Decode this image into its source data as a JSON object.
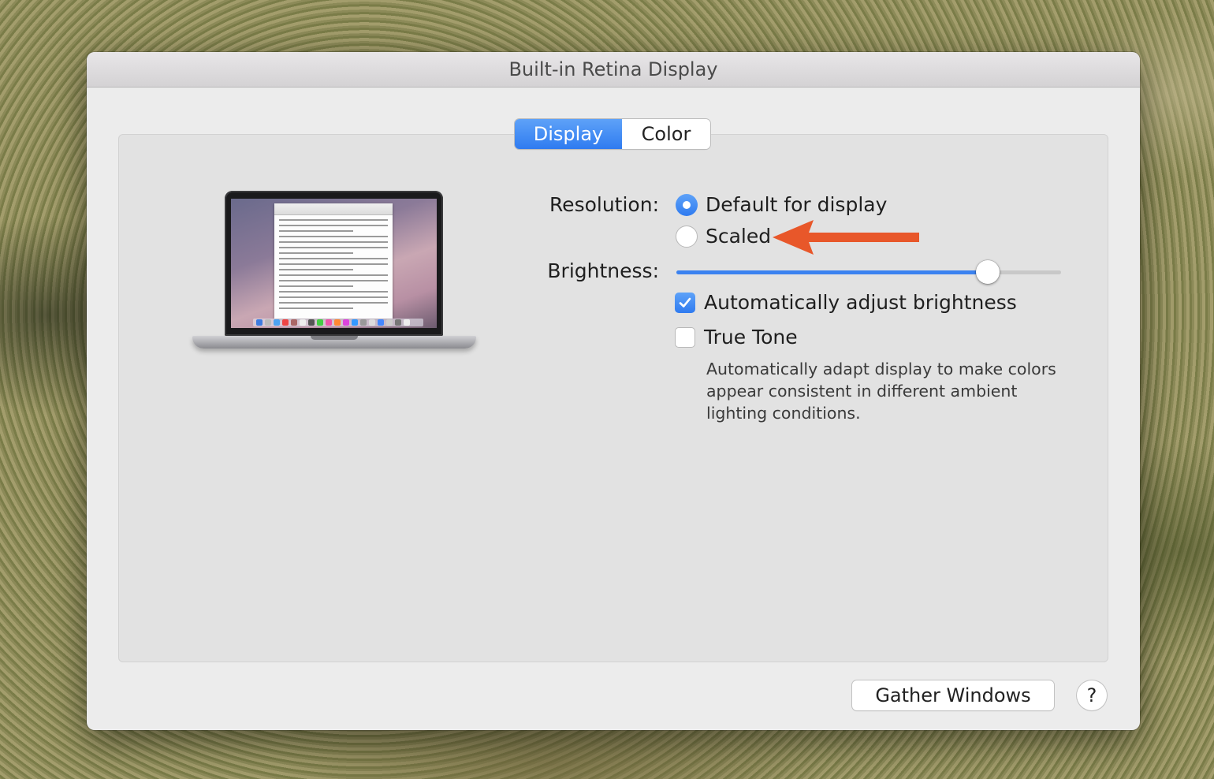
{
  "window": {
    "title": "Built-in Retina Display"
  },
  "tabs": [
    {
      "label": "Display",
      "selected": true
    },
    {
      "label": "Color",
      "selected": false
    }
  ],
  "resolution": {
    "label": "Resolution:",
    "options": [
      {
        "label": "Default for display",
        "selected": true
      },
      {
        "label": "Scaled",
        "selected": false
      }
    ]
  },
  "brightness": {
    "label": "Brightness:",
    "level_percent": 81
  },
  "auto_brightness": {
    "label": "Automatically adjust brightness",
    "checked": true
  },
  "true_tone": {
    "label": "True Tone",
    "checked": false,
    "description": "Automatically adapt display to make colors appear consistent in different ambient lighting conditions."
  },
  "buttons": {
    "gather_windows": "Gather Windows",
    "help": "?"
  },
  "annotation": {
    "arrow_color": "#e8572a",
    "points_to": "Scaled"
  },
  "colors": {
    "accent": "#3b82f0",
    "window_bg": "#ececec",
    "panel_bg": "#e2e2e2"
  },
  "icons": {
    "checkmark": "checkmark-icon",
    "laptop": "laptop-illustration"
  }
}
